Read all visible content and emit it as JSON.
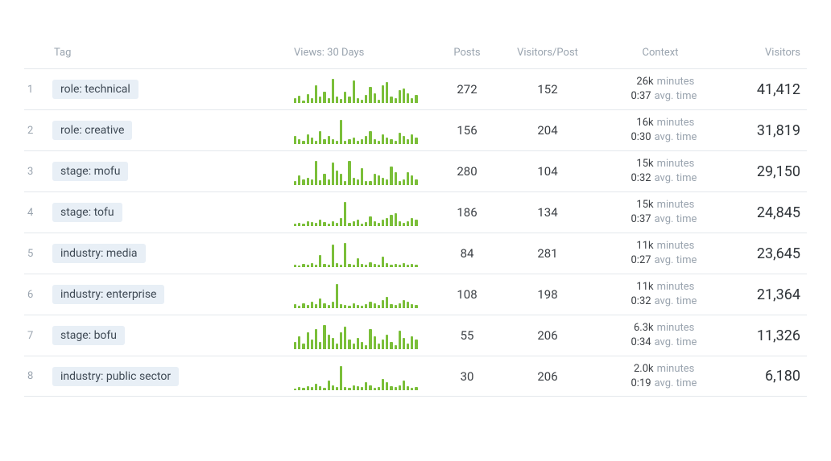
{
  "columns": {
    "rank": "",
    "tag": "Tag",
    "views": "Views: 30 Days",
    "posts": "Posts",
    "visitors_per_post": "Visitors/Post",
    "context": "Context",
    "visitors": "Visitors"
  },
  "context_units": {
    "minutes": "minutes",
    "avg_time": "avg. time"
  },
  "rows": [
    {
      "rank": "1",
      "tag": "role: technical",
      "posts": "272",
      "visitors_per_post": "152",
      "context_minutes": "26k",
      "context_avg_time": "0:37",
      "visitors": "41,412",
      "spark": [
        6,
        9,
        3,
        11,
        6,
        22,
        8,
        14,
        6,
        30,
        8,
        5,
        14,
        8,
        28,
        6,
        4,
        10,
        20,
        12,
        4,
        22,
        26,
        8,
        6,
        16,
        18,
        12,
        6,
        10
      ]
    },
    {
      "rank": "2",
      "tag": "role: creative",
      "posts": "156",
      "visitors_per_post": "204",
      "context_minutes": "16k",
      "context_avg_time": "0:30",
      "visitors": "31,819",
      "spark": [
        10,
        6,
        4,
        12,
        8,
        4,
        16,
        6,
        10,
        6,
        4,
        30,
        4,
        6,
        8,
        4,
        6,
        10,
        16,
        6,
        4,
        12,
        8,
        6,
        4,
        14,
        10,
        6,
        12,
        8
      ]
    },
    {
      "rank": "3",
      "tag": "stage: mofu",
      "posts": "280",
      "visitors_per_post": "104",
      "context_minutes": "15k",
      "context_avg_time": "0:32",
      "visitors": "29,150",
      "spark": [
        4,
        10,
        6,
        8,
        6,
        26,
        5,
        12,
        6,
        24,
        16,
        12,
        4,
        26,
        8,
        6,
        18,
        4,
        4,
        12,
        10,
        8,
        6,
        20,
        14,
        4,
        6,
        14,
        10,
        6
      ]
    },
    {
      "rank": "4",
      "tag": "stage: tofu",
      "posts": "186",
      "visitors_per_post": "134",
      "context_minutes": "15k",
      "context_avg_time": "0:37",
      "visitors": "24,845",
      "spark": [
        3,
        4,
        3,
        6,
        5,
        4,
        8,
        5,
        3,
        6,
        4,
        10,
        30,
        4,
        6,
        8,
        3,
        5,
        12,
        6,
        4,
        8,
        10,
        14,
        16,
        6,
        4,
        6,
        10,
        8
      ]
    },
    {
      "rank": "5",
      "tag": "industry: media",
      "posts": "84",
      "visitors_per_post": "281",
      "context_minutes": "11k",
      "context_avg_time": "0:27",
      "visitors": "23,645",
      "spark": [
        3,
        2,
        4,
        3,
        5,
        3,
        14,
        4,
        3,
        26,
        5,
        3,
        28,
        4,
        3,
        10,
        4,
        3,
        6,
        4,
        3,
        12,
        5,
        3,
        4,
        3,
        5,
        3,
        4,
        3
      ]
    },
    {
      "rank": "6",
      "tag": "industry: enterprise",
      "posts": "108",
      "visitors_per_post": "198",
      "context_minutes": "11k",
      "context_avg_time": "0:32",
      "visitors": "21,364",
      "spark": [
        5,
        3,
        6,
        4,
        8,
        5,
        12,
        6,
        4,
        8,
        30,
        5,
        4,
        3,
        6,
        4,
        3,
        5,
        8,
        6,
        4,
        10,
        14,
        5,
        4,
        6,
        10,
        8,
        5,
        4
      ]
    },
    {
      "rank": "7",
      "tag": "stage: bofu",
      "posts": "55",
      "visitors_per_post": "206",
      "context_minutes": "6.3k",
      "context_avg_time": "0:34",
      "visitors": "11,326",
      "spark": [
        8,
        14,
        6,
        18,
        10,
        22,
        8,
        26,
        16,
        12,
        6,
        18,
        24,
        10,
        6,
        12,
        8,
        4,
        22,
        14,
        6,
        10,
        16,
        8,
        4,
        20,
        12,
        6,
        14,
        10
      ]
    },
    {
      "rank": "8",
      "tag": "industry: public sector",
      "posts": "30",
      "visitors_per_post": "206",
      "context_minutes": "2.0k",
      "context_avg_time": "0:19",
      "visitors": "6,180",
      "spark": [
        2,
        4,
        3,
        5,
        4,
        8,
        5,
        3,
        12,
        6,
        4,
        30,
        4,
        3,
        6,
        5,
        4,
        10,
        6,
        3,
        4,
        14,
        10,
        5,
        4,
        6,
        12,
        5,
        3,
        4
      ]
    }
  ]
}
